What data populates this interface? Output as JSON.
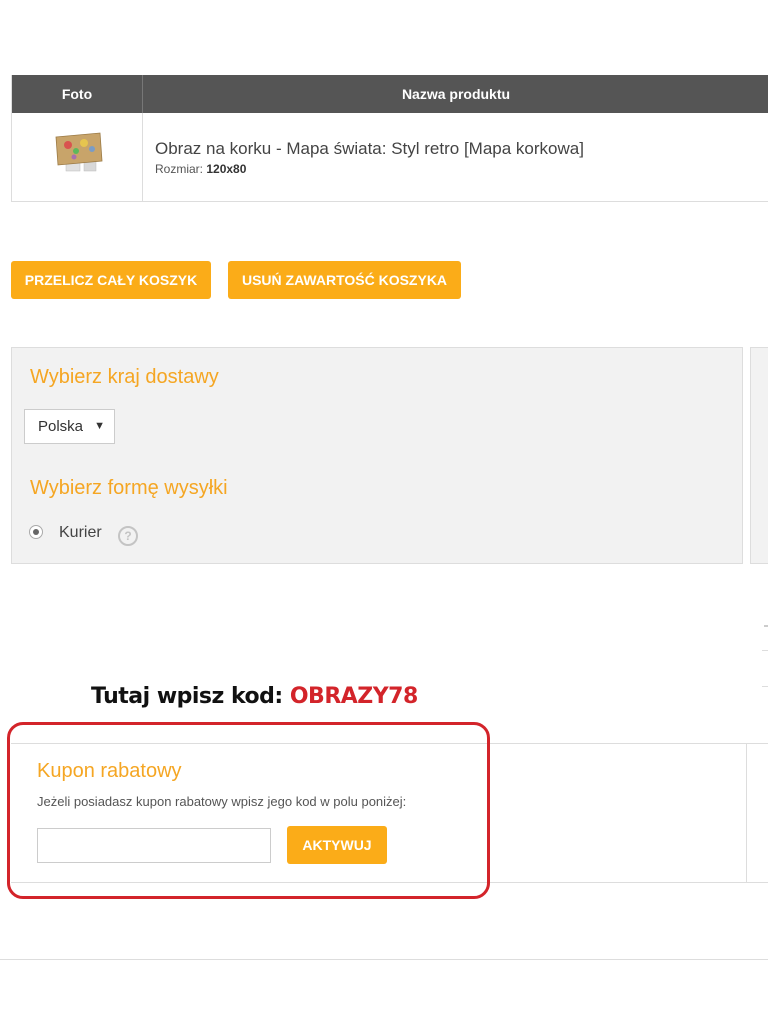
{
  "cart": {
    "headers": {
      "photo": "Foto",
      "name": "Nazwa produktu"
    },
    "item": {
      "name": "Obraz na korku - Mapa świata: Styl retro [Mapa korkowa]",
      "size_label": "Rozmiar:",
      "size_value": "120x80"
    }
  },
  "actions": {
    "recalc_label": "PRZELICZ CAŁY KOSZYK",
    "clear_label": "USUŃ ZAWARTOŚĆ KOSZYKA"
  },
  "shipping": {
    "country_heading": "Wybierz kraj dostawy",
    "country_selected": "Polska",
    "method_heading": "Wybierz formę wysyłki",
    "method_option": "Kurier",
    "method_selected": true,
    "help_glyph": "?"
  },
  "promo": {
    "text": "Tutaj wpisz kod:",
    "code": "OBRAZY78"
  },
  "coupon": {
    "heading": "Kupon rabatowy",
    "description": "Jeżeli posiadasz kupon rabatowy wpisz jego kod w polu poniżej:",
    "input_value": "",
    "activate_label": "AKTYWUJ"
  },
  "colors": {
    "accent": "#fbac18",
    "heading_orange": "#f5a623",
    "table_header": "#555555",
    "highlight_red": "#d3242a"
  },
  "icons": {
    "thumbnail": "world-map-cork-product-thumbnail",
    "select_arrow": "triangle-down-icon",
    "radio": "radio-button-icon",
    "help": "question-mark-circle-icon"
  }
}
